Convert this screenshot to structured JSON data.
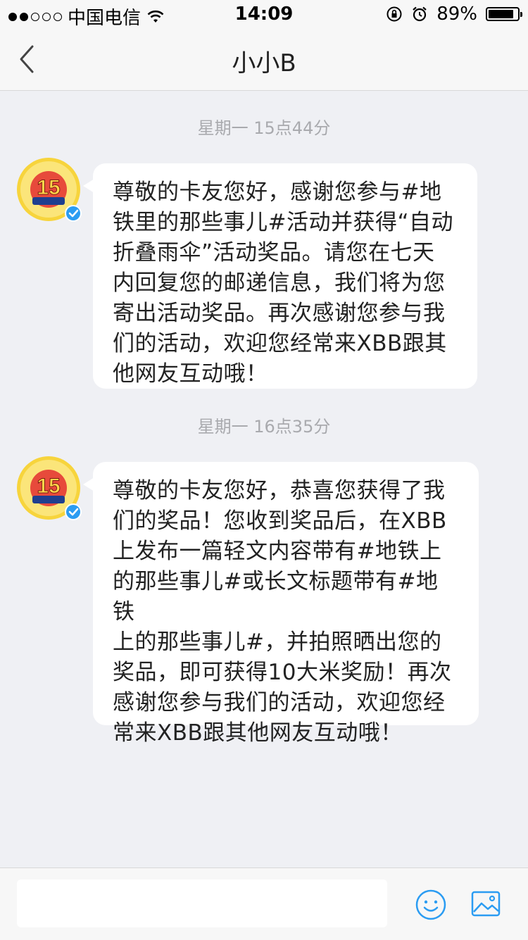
{
  "status_bar": {
    "carrier": "中国电信",
    "time": "14:09",
    "battery_percent_label": "89%",
    "battery_level": 0.89,
    "signal_strength": 2
  },
  "nav": {
    "title": "小小B",
    "back_icon": "chevron-left-icon"
  },
  "messages": [
    {
      "timestamp": "星期一 15点44分",
      "sender_avatar": "xbb-15-avatar",
      "verified": true,
      "text": "尊敬的卡友您好，感谢您参与#地\n铁里的那些事儿#活动并获得“自动\n折叠雨伞”活动奖品。请您在七天\n内回复您的邮递信息，我们将为您\n寄出活动奖品。再次感谢您参与我\n们的活动，欢迎您经常来XBB跟其\n他网友互动哦！"
    },
    {
      "timestamp": "星期一 16点35分",
      "sender_avatar": "xbb-15-avatar",
      "verified": true,
      "text": "尊敬的卡友您好，恭喜您获得了我\n们的奖品！您收到奖品后，在XBB\n上发布一篇轻文内容带有#地铁上\n的那些事儿#或长文标题带有#地铁\n上的那些事儿#，并拍照晒出您的\n奖品，即可获得10大米奖励！再次\n感谢您参与我们的活动，欢迎您经\n常来XBB跟其他网友互动哦！"
    }
  ],
  "input_bar": {
    "placeholder": "",
    "emoji_icon": "smiley-icon",
    "image_icon": "image-icon"
  },
  "colors": {
    "background": "#eff0f4",
    "bubble": "#ffffff",
    "accent_blue": "#2b9cf2",
    "timestamp": "#a9aaae"
  }
}
